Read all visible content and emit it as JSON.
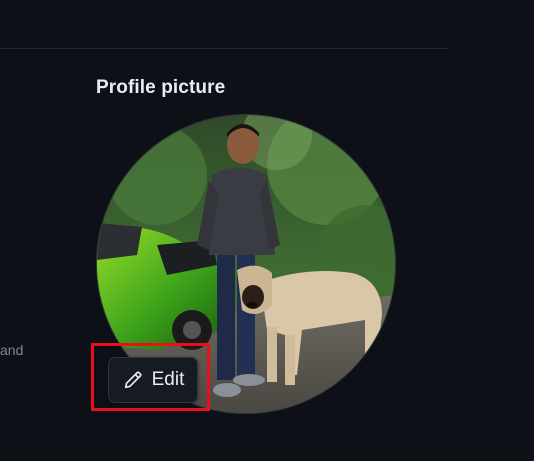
{
  "left_panel": {
    "snippet_text": "and"
  },
  "profile": {
    "section_title": "Profile picture",
    "avatar_alt": "profile photo of a person with a dog next to a green motorcycle",
    "edit_button": {
      "label": "Edit",
      "icon": "pencil-icon"
    }
  },
  "colors": {
    "background": "#0d1117",
    "title_text": "#e6edf3",
    "muted_text": "#7d8590",
    "button_bg": "#161b22",
    "border": "#30363d",
    "highlight": "#e8101a"
  }
}
